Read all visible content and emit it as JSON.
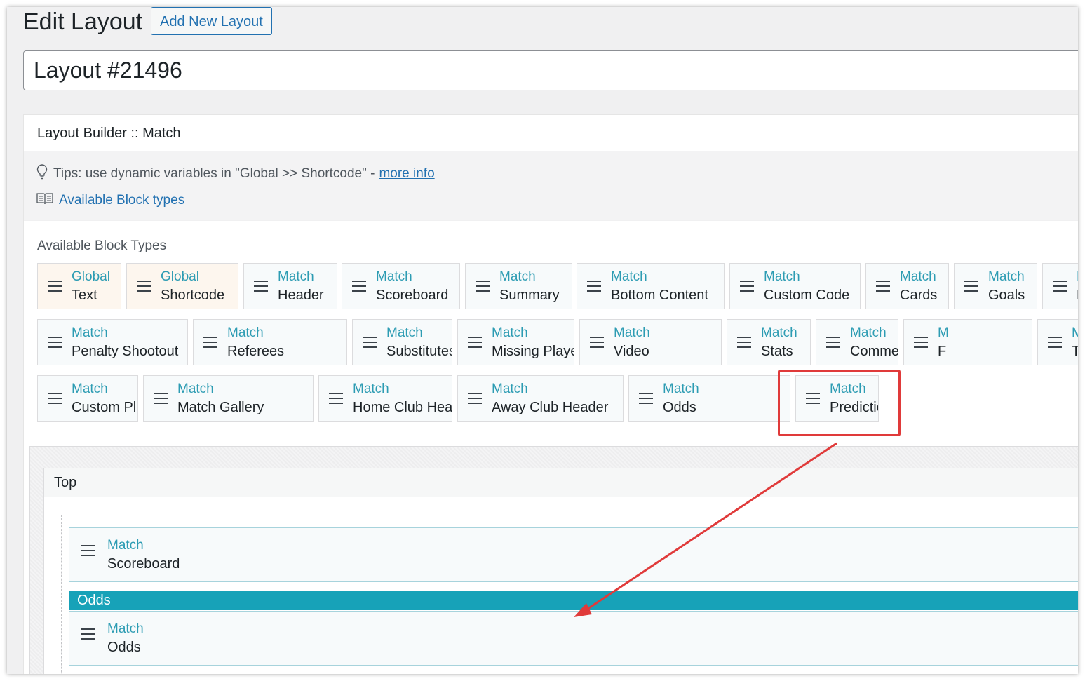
{
  "header": {
    "title": "Edit Layout",
    "add_new_label": "Add New Layout"
  },
  "layout_title": {
    "value": "Layout #21496"
  },
  "builder": {
    "title": "Layout Builder :: Match",
    "tip_text": "Tips: use dynamic variables in \"Global >> Shortcode\" -",
    "tip_link": "more info",
    "block_types_link": "Available Block types",
    "section_label": "Available Block Types"
  },
  "block_types": [
    {
      "cat": "Global",
      "name": "Text"
    },
    {
      "cat": "Global",
      "name": "Shortcode"
    },
    {
      "cat": "Match",
      "name": "Header"
    },
    {
      "cat": "Match",
      "name": "Scoreboard"
    },
    {
      "cat": "Match",
      "name": "Summary"
    },
    {
      "cat": "Match",
      "name": "Bottom Content"
    },
    {
      "cat": "Match",
      "name": "Custom Code"
    },
    {
      "cat": "Match",
      "name": "Cards"
    },
    {
      "cat": "Match",
      "name": "Goals"
    },
    {
      "cat": "Match",
      "name": "Missed Penalties"
    },
    {
      "cat": "Match",
      "name": "Penalty Shootout"
    },
    {
      "cat": "Match",
      "name": "Referees"
    },
    {
      "cat": "Match",
      "name": "Substitutes"
    },
    {
      "cat": "Match",
      "name": "Missing Players"
    },
    {
      "cat": "Match",
      "name": "Video"
    },
    {
      "cat": "Match",
      "name": "Stats"
    },
    {
      "cat": "Match",
      "name": "Commentary"
    },
    {
      "cat": "M",
      "name": "F"
    },
    {
      "cat": "Match",
      "name": "Timeline"
    },
    {
      "cat": "Match",
      "name": "Custom Player Stats"
    },
    {
      "cat": "Match",
      "name": "Match Gallery"
    },
    {
      "cat": "Match",
      "name": "Home Club Header"
    },
    {
      "cat": "Match",
      "name": "Away Club Header"
    },
    {
      "cat": "Match",
      "name": "Odds"
    },
    {
      "cat": "Match",
      "name": "Prediction"
    }
  ],
  "top_section": {
    "title": "Top",
    "placed": [
      {
        "cat": "Match",
        "name": "Scoreboard"
      },
      {
        "cat": "Match",
        "name": "Odds"
      }
    ],
    "odds_bar_label": "Odds"
  },
  "colors": {
    "accent": "#2271b1",
    "category_text": "#2d9cb3",
    "odds_bar": "#17a2b8",
    "highlight": "#e03a3a",
    "global_block_bg": "#fdf6ee"
  },
  "icons": {
    "drag_handle": "hamburger-icon",
    "tip": "lightbulb-icon",
    "docs": "book-icon"
  }
}
